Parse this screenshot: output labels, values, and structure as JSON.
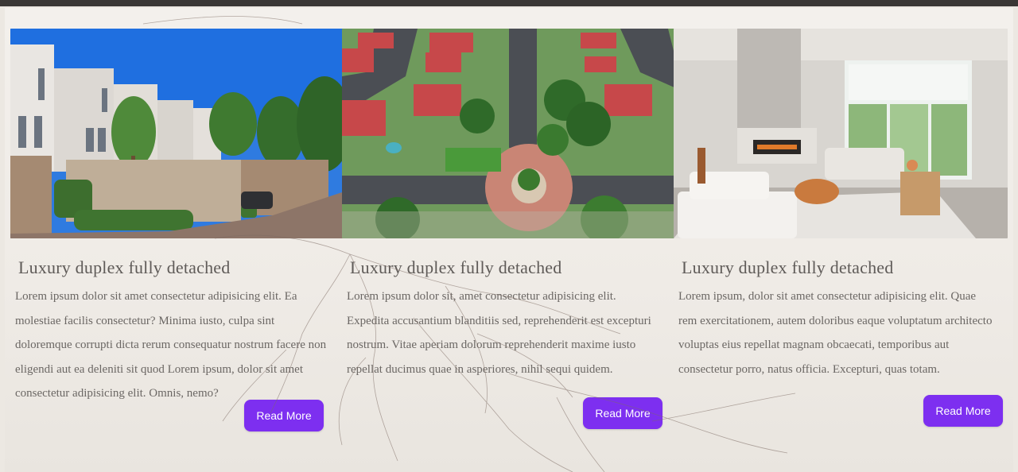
{
  "cards": [
    {
      "image_alt": "Modern townhouses along a quiet street",
      "title": "Luxury duplex fully detached",
      "body": "Lorem ipsum dolor sit amet consectetur adipisicing elit. Ea molestiae facilis consectetur? Minima iusto, culpa sint doloremque corrupti dicta rerum consequatur nostrum facere non eligendi aut ea deleniti sit quod Lorem ipsum, dolor sit amet consectetur adipisicing elit. Omnis, nemo?",
      "button_label": "Read More"
    },
    {
      "image_alt": "Aerial view of a suburban roundabout",
      "title": "Luxury duplex fully detached",
      "body": "Lorem ipsum dolor sit, amet consectetur adipisicing elit. Expedita accusantium blanditiis sed, reprehenderit est excepturi nostrum. Vitae aperiam dolorum reprehenderit maxime iusto repellat ducimus quae in asperiores, nihil sequi quidem.",
      "button_label": "Read More"
    },
    {
      "image_alt": "Bright living room with fireplace",
      "title": "Luxury duplex fully detached",
      "body": "Lorem ipsum, dolor sit amet consectetur adipisicing elit. Quae rem exercitationem, autem doloribus eaque voluptatum architecto voluptas eius repellat magnam obcaecati, temporibus aut consectetur porro, natus officia. Excepturi, quas totam.",
      "button_label": "Read More"
    }
  ],
  "colors": {
    "button": "#7d2ff0",
    "button_text": "#ffffff",
    "heading": "#5f5b58",
    "body_text": "#6b6764"
  }
}
